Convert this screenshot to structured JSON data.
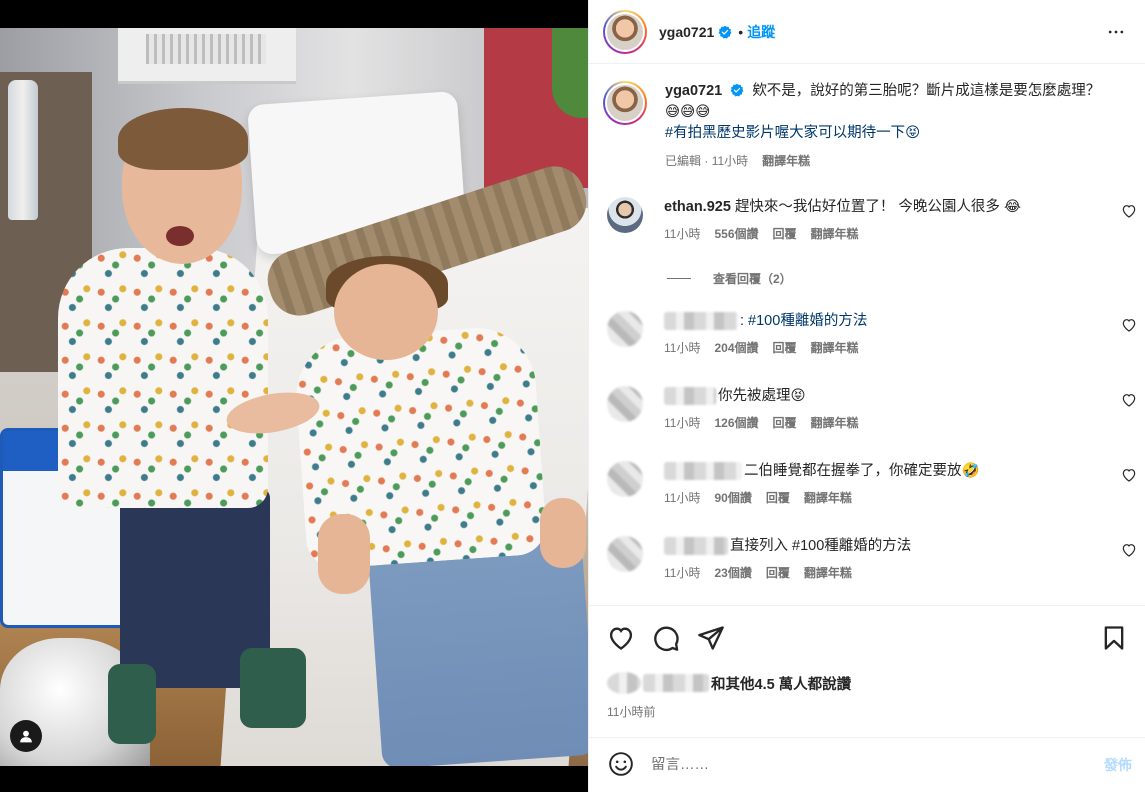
{
  "post": {
    "username": "yga0721",
    "follow_label": "追蹤",
    "caption_username": "yga0721",
    "caption_text": "欸不是，說好的第三胎呢？斷片成這樣是要怎麼處理？😅😅😅",
    "caption_hashtag": "#有拍黑歷史影片喔大家可以期待一下😝",
    "caption_edited": "已編輯",
    "caption_time": "11小時",
    "caption_translate": "翻譯年糕"
  },
  "comments": [
    {
      "username": "ethan.925",
      "text": "趕快來～我佔好位置了！ 今晚公園人很多 😂",
      "time": "11小時",
      "likes": "556個讚",
      "reply": "回覆",
      "translate": "翻譯年糕"
    },
    {
      "username": "",
      "text": ": #100種離婚的方法",
      "time": "11小時",
      "likes": "204個讚",
      "reply": "回覆",
      "translate": "翻譯年糕"
    },
    {
      "username": "",
      "text": "你先被處理😝",
      "time": "11小時",
      "likes": "126個讚",
      "reply": "回覆",
      "translate": "翻譯年糕"
    },
    {
      "username": "",
      "text": "二伯睡覺都在握拳了，你確定要放🤣",
      "time": "11小時",
      "likes": "90個讚",
      "reply": "回覆",
      "translate": "翻譯年糕"
    },
    {
      "username": "",
      "text": "直接列入 #100種離婚的方法",
      "time": "11小時",
      "likes": "23個讚",
      "reply": "回覆",
      "translate": "翻譯年糕"
    }
  ],
  "view_replies": "查看回覆（2）",
  "likes_summary": "和其他4.5 萬人都說讚",
  "post_time": "11小時前",
  "add_comment": {
    "placeholder": "留言……",
    "post_label": "發佈"
  },
  "colors": {
    "link_blue": "#0095f6",
    "hashtag_blue": "#00376b",
    "muted_gray": "#737373",
    "disabled_post": "#b3dbff"
  }
}
